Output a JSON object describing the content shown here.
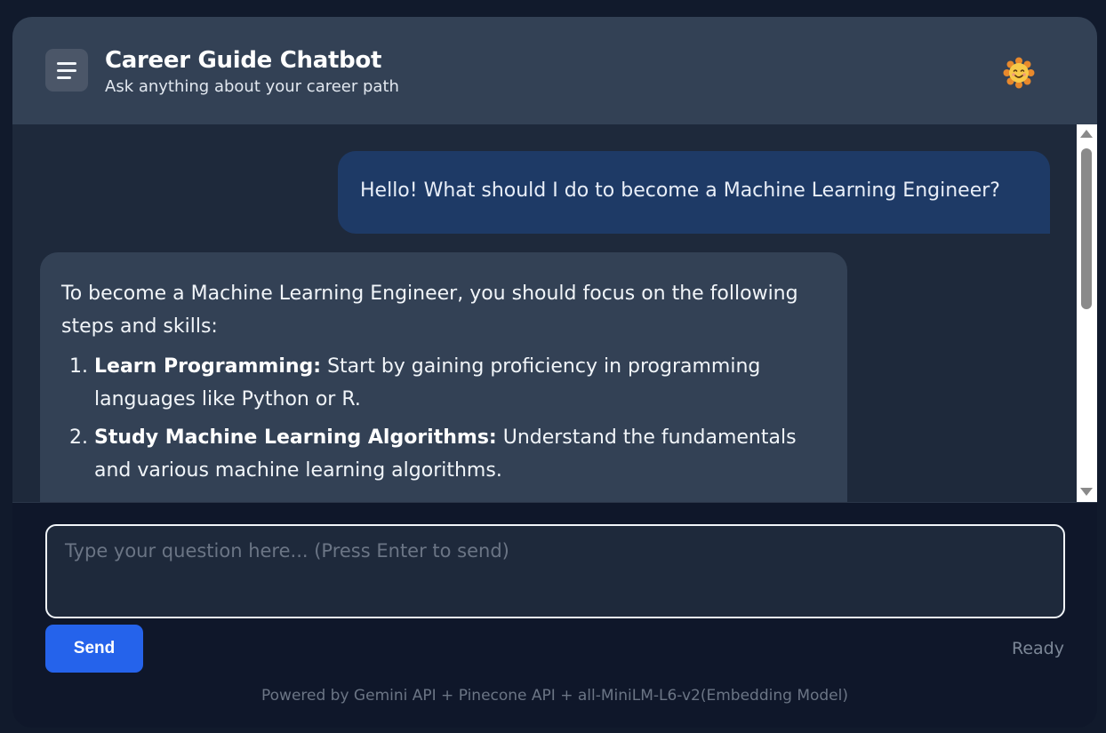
{
  "header": {
    "title": "Career Guide Chatbot",
    "subtitle": "Ask anything about your career path",
    "menu_icon": "hamburger-menu-icon",
    "avatar_icon": "smiling-sun-emoji-icon"
  },
  "messages": {
    "user": "Hello! What should I do to become a Machine Learning Engineer?",
    "bot": {
      "intro": "To become a Machine Learning Engineer, you should focus on the following steps and skills:",
      "items": [
        {
          "title": "Learn Programming:",
          "text": " Start by gaining proficiency in programming languages like Python or R."
        },
        {
          "title": "Study Machine Learning Algorithms:",
          "text": " Understand the fundamentals and various machine learning algorithms."
        }
      ]
    }
  },
  "composer": {
    "placeholder": "Type your question here... (Press Enter to send)",
    "send_label": "Send",
    "status": "Ready"
  },
  "footer": {
    "text": "Powered by Gemini API + Pinecone API + all-MiniLM-L6-v2(Embedding Model)"
  },
  "colors": {
    "accent": "#2563eb",
    "user_bubble": "#1e3a66",
    "bot_bubble": "#334155",
    "header": "#334155",
    "background": "#0f172a"
  }
}
